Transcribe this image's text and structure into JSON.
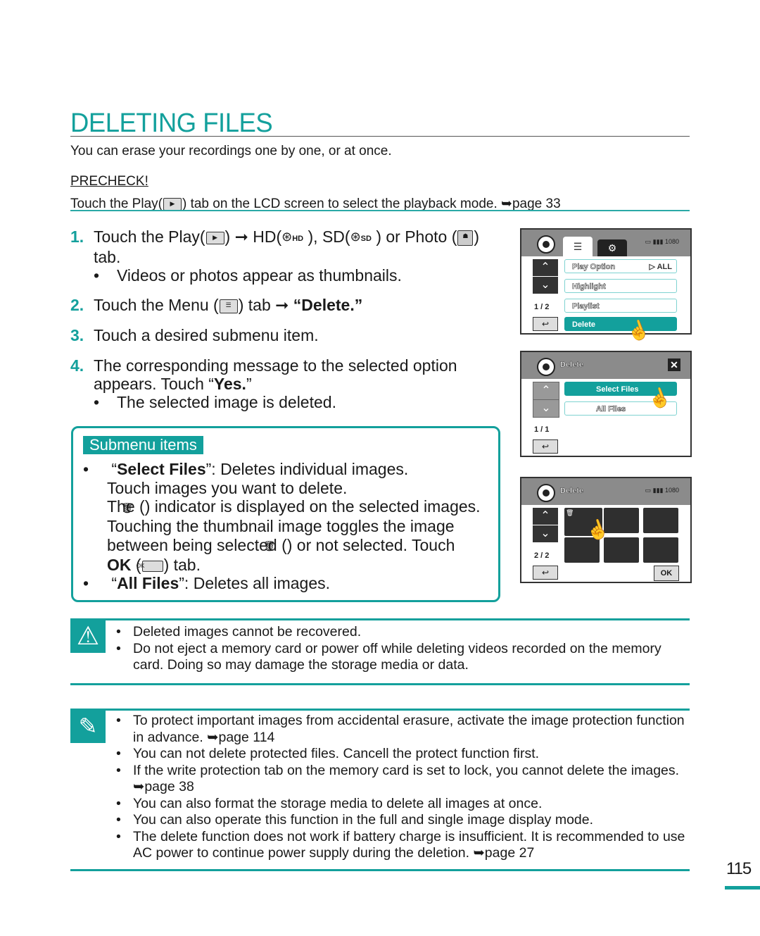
{
  "header": {
    "title": "DELETING FILES",
    "intro": "You can erase your recordings one by one, or at once."
  },
  "precheck": {
    "label": "PRECHECK!",
    "text_before": "Touch the Play(",
    "text_after": ") tab on the LCD screen to select the playback mode. ",
    "page_ref": "➥page 33"
  },
  "steps": [
    {
      "num": "1.",
      "parts": [
        "Touch the Play(",
        ") ➞ HD(",
        " ), SD(",
        " ) or Photo (",
        ")"
      ],
      "hd_label": "HD",
      "sd_label": "SD",
      "cont": "tab.",
      "bullet": "Videos or photos appear as thumbnails."
    },
    {
      "num": "2.",
      "text_before": "Touch the Menu (",
      "text_after": ") tab ➞ ",
      "bold": "“Delete.”"
    },
    {
      "num": "3.",
      "text": "Touch a desired submenu item."
    },
    {
      "num": "4.",
      "text": "The corresponding message to the selected option",
      "cont_before": "appears. Touch “",
      "cont_bold": "Yes.",
      "cont_after": "”",
      "bullet": "The selected image is deleted."
    }
  ],
  "submenu": {
    "label": "Submenu items",
    "select_files": {
      "open_quote": "“",
      "name": "Select Files",
      "desc": "”: Deletes individual images.",
      "line2": "Touch images you want to delete.",
      "line3_before": "The (",
      "line3_after": ") indicator is displayed on the selected images.",
      "line4": "Touching the thumbnail image toggles the image",
      "line5_before": "between being selected (",
      "line5_after": ") or not selected. Touch",
      "ok_bold": "OK",
      "ok_before": " (",
      "ok_icon": "OK",
      "ok_after": ") tab."
    },
    "all_files": {
      "open_quote": "“",
      "name": "All Files",
      "desc": "”: Deletes all images."
    }
  },
  "lcd1": {
    "tab_menu_icon": "☰",
    "tab_settings_icon": "⚙",
    "status": "▭ ▮▮▮ 1080",
    "items": [
      {
        "label": "Play Option",
        "value": "▷ ALL"
      },
      {
        "label": "Highlight"
      },
      {
        "label": "Playlist"
      },
      {
        "label": "Delete"
      }
    ],
    "up": "⌃",
    "down": "⌄",
    "pager": "1 / 2",
    "back": "↩"
  },
  "lcd2": {
    "title": "Delete",
    "close": "✕",
    "items": [
      {
        "label": "Select Files"
      },
      {
        "label": "All Files"
      }
    ],
    "up": "⌃",
    "down": "⌄",
    "pager": "1 / 1",
    "back": "↩"
  },
  "lcd3": {
    "title": "Delete",
    "status": "▭ ▮▮▮ 1080",
    "up": "⌃",
    "down": "⌄",
    "pager": "2 / 2",
    "back": "↩",
    "ok": "OK",
    "thumbnail_count": 6,
    "selected_marker": "🗑"
  },
  "caution": {
    "items": [
      "Deleted images cannot be recovered.",
      "Do not eject a memory card or power off while deleting videos recorded on the memory card. Doing so may damage the storage media or data."
    ]
  },
  "notes": {
    "items": [
      "To protect important images from accidental erasure, activate the image protection function in advance. ➥page 114",
      "You can not delete protected files. Cancell the protect function first.",
      "If the write protection tab on the memory card is set to lock, you cannot delete the images. ➥page 38",
      "You can also format the storage media to delete all images at once.",
      "You can also operate this function in the full and single image display mode.",
      "The delete function does not work if battery charge is  insufficient. It is recommended to use AC power to continue power supply during the deletion. ➥page 27"
    ]
  },
  "footer": {
    "page_number": "115"
  },
  "colors": {
    "accent": "#13a09c",
    "lcd_header": "#8b8b8b",
    "text": "#1a1a1a"
  }
}
